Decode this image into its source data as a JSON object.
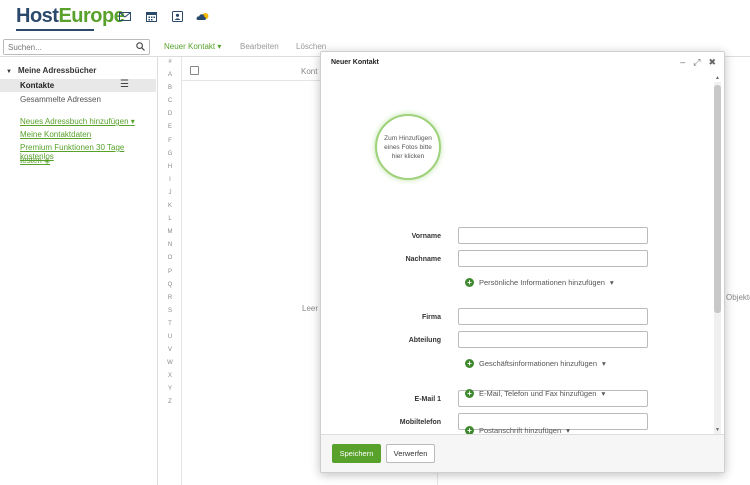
{
  "header": {
    "logo_main": "Host",
    "logo_accent": "Europe",
    "icons": [
      "mail-icon",
      "calendar-icon",
      "contacts-icon",
      "cloud-icon"
    ]
  },
  "toolbar": {
    "search_placeholder": "Suchen...",
    "new_contact": "Neuer Kontakt",
    "edit": "Bearbeiten",
    "delete": "Löschen"
  },
  "sidebar": {
    "heading": "Meine Adressbücher",
    "active_item": "Kontakte",
    "item_collected": "Gesammelte Adressen",
    "link_new_book": "Neues Adressbuch hinzufügen",
    "link_my_contact": "Meine Kontaktdaten",
    "link_premium_1": "Premium Funktionen 30 Tage kostenlos",
    "link_premium_2": "testen"
  },
  "index": {
    "letters": [
      "#",
      "A",
      "B",
      "C",
      "D",
      "E",
      "F",
      "G",
      "H",
      "I",
      "J",
      "K",
      "L",
      "M",
      "N",
      "O",
      "P",
      "Q",
      "R",
      "S",
      "T",
      "U",
      "V",
      "W",
      "X",
      "Y",
      "Z"
    ]
  },
  "list": {
    "title_partial": "Kont",
    "empty_partial": "Leer",
    "objects_partial": "Objekte"
  },
  "modal": {
    "title": "Neuer Kontakt",
    "photo_text": "Zum Hinzufügen eines Fotos bitte hier klicken",
    "fields": {
      "first_name": "Vorname",
      "last_name": "Nachname",
      "company": "Firma",
      "department": "Abteilung",
      "email1": "E-Mail 1",
      "mobile": "Mobiltelefon"
    },
    "add_personal": "Persönliche Informationen hinzufügen",
    "add_business": "Geschäftsinformationen hinzufügen",
    "add_contact": "E-Mail, Telefon und Fax hinzufügen",
    "add_address": "Postanschrift hinzufügen",
    "save": "Speichern",
    "discard": "Verwerfen"
  },
  "colors": {
    "brand_green": "#58a12b",
    "brand_blue": "#2b4a6b"
  }
}
